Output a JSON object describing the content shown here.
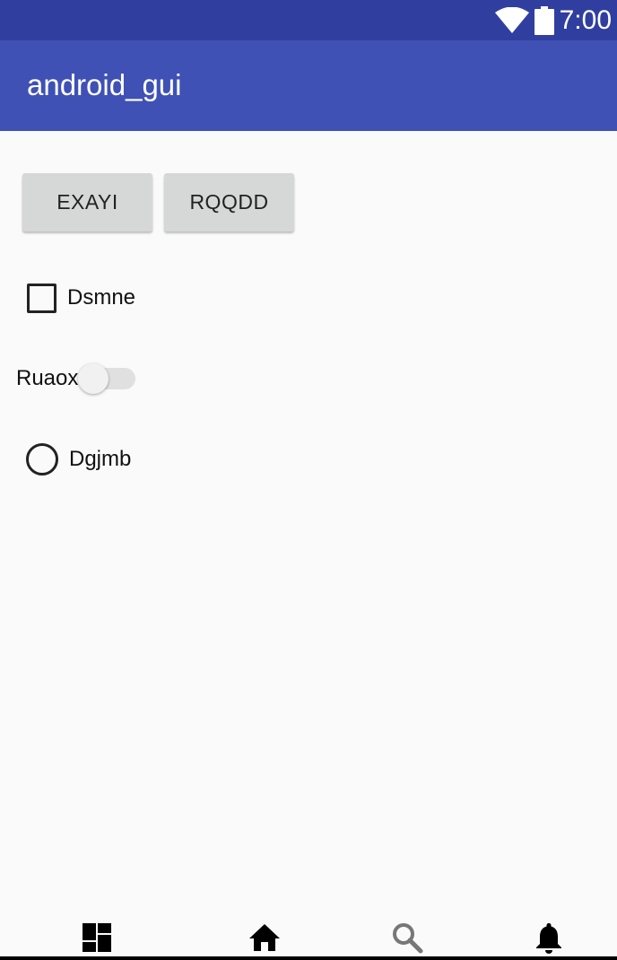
{
  "status_bar": {
    "time": "7:00",
    "icons": [
      "wifi-icon",
      "battery-icon"
    ]
  },
  "app_bar": {
    "title": "android_gui"
  },
  "buttons": [
    {
      "label": "EXAYI"
    },
    {
      "label": "RQQDD"
    }
  ],
  "checkbox": {
    "label": "Dsmne",
    "checked": false
  },
  "switch": {
    "label": "Ruaox",
    "on": false
  },
  "radio": {
    "label": "Dgjmb",
    "selected": false
  },
  "bottom_nav": {
    "items": [
      "dashboard-icon",
      "home-icon",
      "search-icon",
      "notifications-icon"
    ]
  },
  "colors": {
    "status_bar": "#303f9f",
    "app_bar": "#3f51b5",
    "background": "#fafafa",
    "button": "#d6d7d7"
  }
}
